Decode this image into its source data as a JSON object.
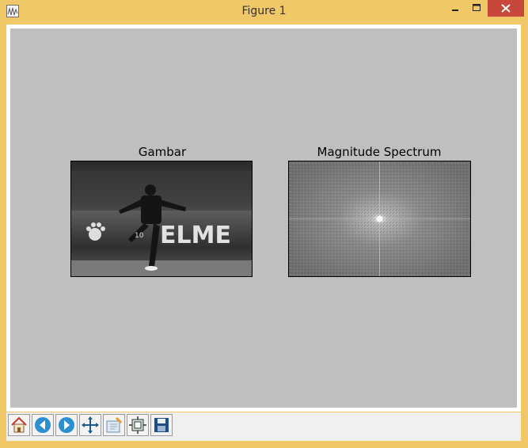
{
  "window": {
    "title": "Figure 1",
    "icons": {
      "app": "waveform-icon",
      "minimize": "minimize-icon",
      "maximize": "maximize-icon",
      "close": "close-icon"
    }
  },
  "figure": {
    "axes": [
      {
        "title": "Gambar",
        "content": "grayscale photo of a football player celebrating in a stadium"
      },
      {
        "title": "Magnitude Spectrum",
        "content": "Fourier magnitude spectrum with bright center and cross lines"
      }
    ]
  },
  "toolbar": {
    "buttons": [
      {
        "icon": "home-icon"
      },
      {
        "icon": "back-arrow-icon"
      },
      {
        "icon": "forward-arrow-icon"
      },
      {
        "icon": "pan-icon"
      },
      {
        "icon": "zoom-rect-icon"
      },
      {
        "icon": "subplots-config-icon"
      },
      {
        "icon": "save-icon"
      }
    ]
  },
  "colors": {
    "titlebar": "#f0c868",
    "canvas": "#bfbfbf",
    "close_button": "#c7473a"
  }
}
